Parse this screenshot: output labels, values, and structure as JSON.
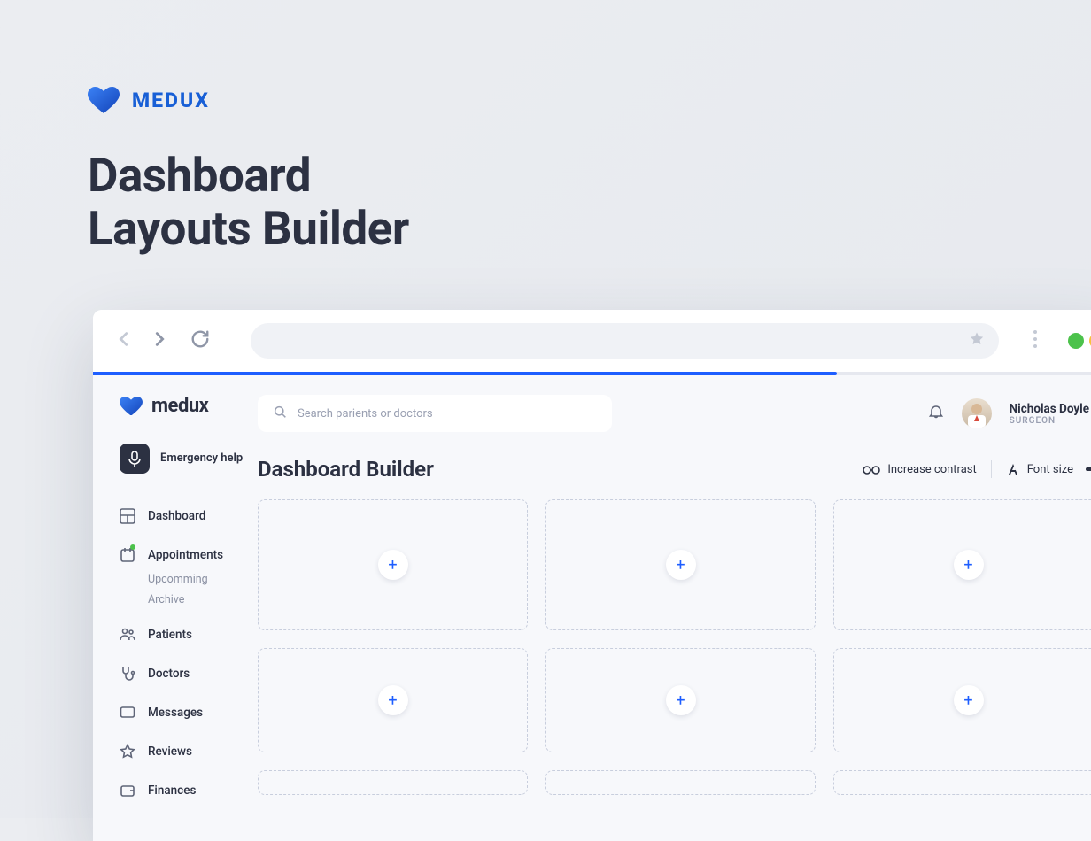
{
  "hero": {
    "brand": "MEDUX",
    "title_line1": "Dashboard",
    "title_line2": "Layouts Builder"
  },
  "app": {
    "brand": "medux",
    "search_placeholder": "Search parients or doctors",
    "user": {
      "name": "Nicholas Doyle",
      "role": "SURGEON"
    },
    "emergency_label": "Emergency help",
    "nav": [
      {
        "icon": "dashboard",
        "label": "Dashboard"
      },
      {
        "icon": "calendar",
        "label": "Appointments",
        "badge": true,
        "sub": [
          {
            "label": "Upcomming"
          },
          {
            "label": "Archive"
          }
        ]
      },
      {
        "icon": "patients",
        "label": "Patients"
      },
      {
        "icon": "doctors",
        "label": "Doctors"
      },
      {
        "icon": "messages",
        "label": "Messages"
      },
      {
        "icon": "reviews",
        "label": "Reviews"
      },
      {
        "icon": "finances",
        "label": "Finances"
      }
    ],
    "page_title": "Dashboard Builder",
    "tools": {
      "contrast": "Increase contrast",
      "fontsize": "Font size"
    },
    "slots": 9
  },
  "colors": {
    "primary": "#1e5eff",
    "text": "#2c3142"
  }
}
